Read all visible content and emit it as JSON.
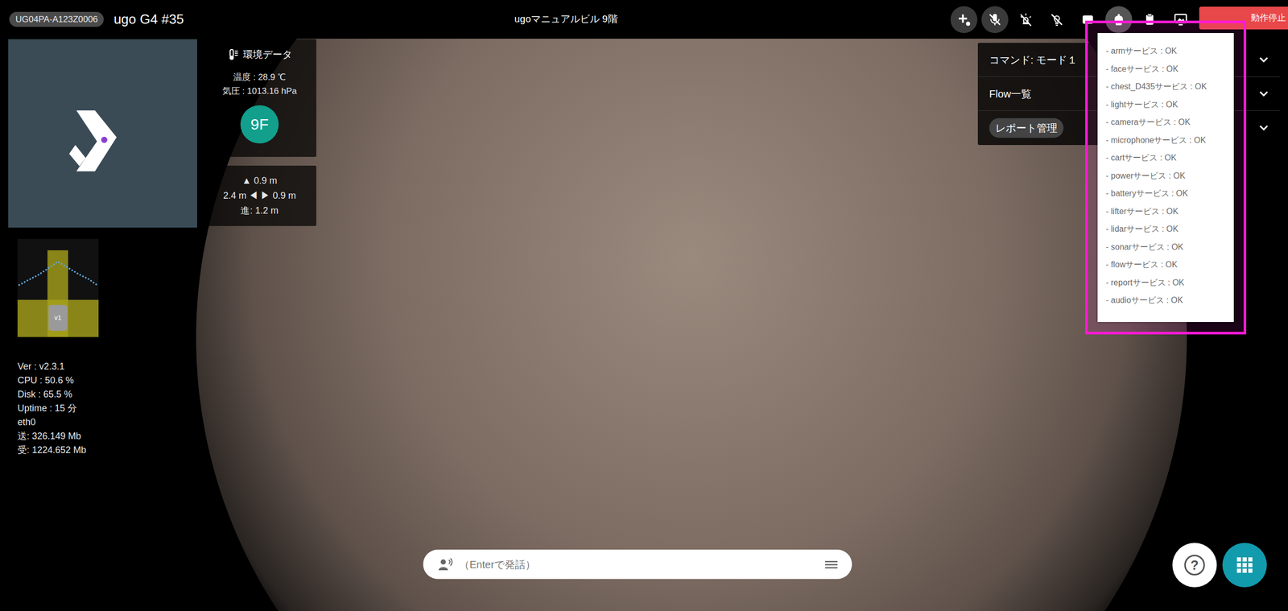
{
  "header": {
    "robot_id": "UG04PA-A123Z0006",
    "robot_name": "ugo G4 #35",
    "location": "ugoマニュアルビル 9階",
    "toolbar": [
      {
        "kind": "add",
        "framed": true,
        "selected": false
      },
      {
        "kind": "mic-off",
        "framed": true,
        "selected": false
      },
      {
        "kind": "light-off",
        "framed": false,
        "selected": false
      },
      {
        "kind": "bulb-off",
        "framed": false,
        "selected": false
      },
      {
        "kind": "screen",
        "framed": false,
        "selected": false
      },
      {
        "kind": "robot",
        "framed": false,
        "selected": true
      },
      {
        "kind": "clipboard",
        "framed": false,
        "selected": false
      },
      {
        "kind": "monitor",
        "framed": false,
        "selected": false
      }
    ],
    "stop_button": "動作停止"
  },
  "environment": {
    "title": "環境データ",
    "temperature": "温度 : 28.9 ℃",
    "pressure": "気圧 : 1013.16 hPa",
    "floor": "9F"
  },
  "distances": {
    "front": "▲ 0.9 m",
    "sides": "2.4 m ◀ ▶ 0.9 m",
    "forward": "進: 1.2 m"
  },
  "sensor": {
    "label": "v1"
  },
  "stats": [
    "Ver : v2.3.1",
    "CPU : 50.6 %",
    "Disk : 65.5 %",
    "Uptime : 15 分",
    "eth0",
    "送: 326.149 Mb",
    "受: 1224.652 Mb"
  ],
  "panels": [
    {
      "label": "コマンド: モード１",
      "expanded": false
    },
    {
      "label": "Flow一覧",
      "expanded": false
    },
    {
      "label": "レポート管理",
      "expanded": false
    }
  ],
  "services": {
    "open": true,
    "items": [
      "- armサービス : OK",
      "- faceサービス : OK",
      "- chest_D435サービス : OK",
      "- lightサービス : OK",
      "- cameraサービス : OK",
      "- microphoneサービス : OK",
      "- cartサービス : OK",
      "- powerサービス : OK",
      "- batteryサービス : OK",
      "- lifterサービス : OK",
      "- lidarサービス : OK",
      "- sonarサービス : OK",
      "- flowサービス : OK",
      "- reportサービス : OK",
      "- audioサービス : OK"
    ]
  },
  "speech_input": {
    "placeholder": "（Enterで発話）"
  },
  "help_button": "?"
}
